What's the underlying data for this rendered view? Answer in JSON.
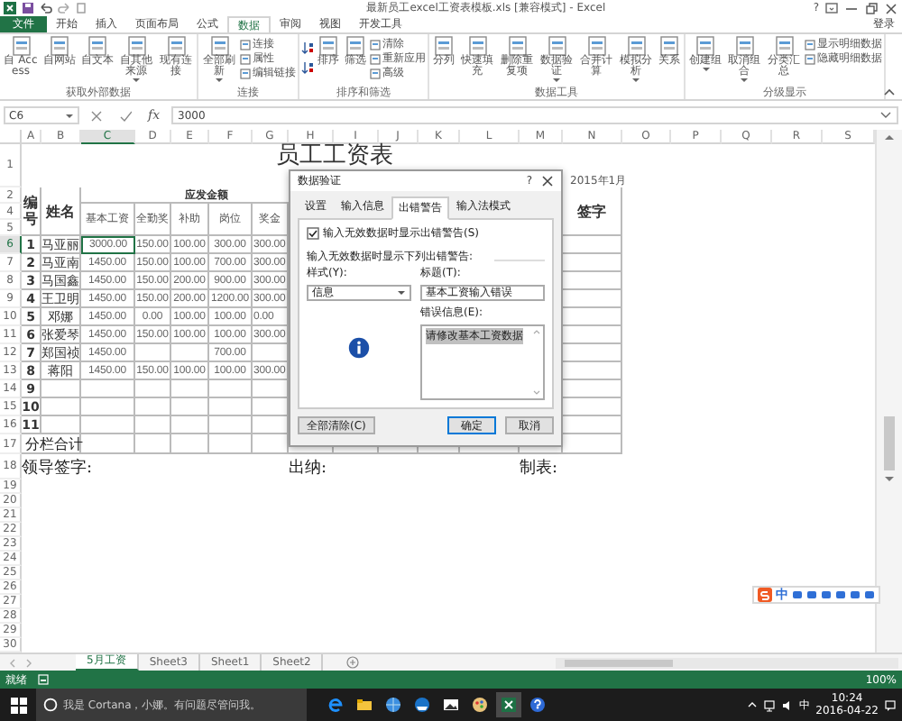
{
  "window": {
    "title": "最新员工excel工资表模板.xls  [兼容模式] - Excel",
    "help": "?"
  },
  "ribbon_tabs": [
    {
      "label": "文件",
      "kind": "file",
      "selected": false
    },
    {
      "label": "开始",
      "kind": "tab",
      "selected": false
    },
    {
      "label": "插入",
      "kind": "tab",
      "selected": false
    },
    {
      "label": "页面布局",
      "kind": "tab",
      "selected": false
    },
    {
      "label": "公式",
      "kind": "tab",
      "selected": false
    },
    {
      "label": "数据",
      "kind": "tab",
      "selected": true
    },
    {
      "label": "审阅",
      "kind": "tab",
      "selected": false
    },
    {
      "label": "视图",
      "kind": "tab",
      "selected": false
    },
    {
      "label": "开发工具",
      "kind": "tab",
      "selected": false
    }
  ],
  "sign_in": "登录",
  "ribbon_groups": [
    {
      "title": "获取外部数据",
      "items": [
        {
          "kind": "large",
          "label": "自 Access",
          "dropdown": false
        },
        {
          "kind": "large",
          "label": "自网站",
          "dropdown": false
        },
        {
          "kind": "large",
          "label": "自文本",
          "dropdown": false
        },
        {
          "kind": "large",
          "label": "自其他来源",
          "dropdown": true
        },
        {
          "kind": "large",
          "label": "现有连接",
          "dropdown": false
        }
      ]
    },
    {
      "title": "连接",
      "items": [
        {
          "kind": "large",
          "label": "全部刷新",
          "dropdown": true
        },
        {
          "kind": "small",
          "label": "连接",
          "dropdown": false
        },
        {
          "kind": "small",
          "label": "属性",
          "dropdown": false
        },
        {
          "kind": "small",
          "label": "编辑链接",
          "dropdown": false
        }
      ]
    },
    {
      "title": "排序和筛选",
      "items": [
        {
          "kind": "sort"
        },
        {
          "kind": "sort"
        },
        {
          "kind": "large",
          "label": "排序",
          "dropdown": false
        },
        {
          "kind": "large",
          "label": "筛选",
          "dropdown": false
        },
        {
          "kind": "small",
          "label": "清除",
          "dropdown": false
        },
        {
          "kind": "small",
          "label": "重新应用",
          "dropdown": false
        },
        {
          "kind": "small",
          "label": "高级",
          "dropdown": false
        }
      ]
    },
    {
      "title": "数据工具",
      "items": [
        {
          "kind": "large",
          "label": "分列",
          "dropdown": false
        },
        {
          "kind": "large",
          "label": "快速填充",
          "dropdown": false
        },
        {
          "kind": "large",
          "label": "删除重复项",
          "dropdown": false
        },
        {
          "kind": "large",
          "label": "数据验证",
          "dropdown": true
        },
        {
          "kind": "large",
          "label": "合并计算",
          "dropdown": false
        },
        {
          "kind": "large",
          "label": "模拟分析",
          "dropdown": true
        },
        {
          "kind": "large",
          "label": "关系",
          "dropdown": false
        }
      ]
    },
    {
      "title": "分级显示",
      "items": [
        {
          "kind": "large",
          "label": "创建组",
          "dropdown": true
        },
        {
          "kind": "large",
          "label": "取消组合",
          "dropdown": true
        },
        {
          "kind": "large",
          "label": "分类汇总",
          "dropdown": false
        },
        {
          "kind": "small",
          "label": "显示明细数据",
          "dropdown": false
        },
        {
          "kind": "small",
          "label": "隐藏明细数据",
          "dropdown": false
        }
      ]
    }
  ],
  "formula_bar": {
    "name_box": "C6",
    "function_label": "fx",
    "value": "3000"
  },
  "sheet": {
    "columns": [
      {
        "label": "A",
        "selected": false
      },
      {
        "label": "B",
        "selected": false
      },
      {
        "label": "C",
        "selected": true
      },
      {
        "label": "D",
        "selected": false
      },
      {
        "label": "E",
        "selected": false
      },
      {
        "label": "F",
        "selected": false
      },
      {
        "label": "G",
        "selected": false
      },
      {
        "label": "H",
        "selected": false
      },
      {
        "label": "I",
        "selected": false
      },
      {
        "label": "J",
        "selected": false
      },
      {
        "label": "K",
        "selected": false
      },
      {
        "label": "L",
        "selected": false
      },
      {
        "label": "M",
        "selected": false
      },
      {
        "label": "N",
        "selected": false
      },
      {
        "label": "O",
        "selected": false
      },
      {
        "label": "P",
        "selected": false
      },
      {
        "label": "Q",
        "selected": false
      },
      {
        "label": "R",
        "selected": false
      },
      {
        "label": "S",
        "selected": false
      }
    ],
    "row_numbers": [
      {
        "label": "1",
        "selected": false
      },
      {
        "label": "2",
        "selected": false
      },
      {
        "label": "4",
        "selected": false
      },
      {
        "label": "5",
        "selected": false
      },
      {
        "label": "6",
        "selected": true
      },
      {
        "label": "7",
        "selected": false
      },
      {
        "label": "8",
        "selected": false
      },
      {
        "label": "9",
        "selected": false
      },
      {
        "label": "10",
        "selected": false
      },
      {
        "label": "11",
        "selected": false
      },
      {
        "label": "12",
        "selected": false
      },
      {
        "label": "13",
        "selected": false
      },
      {
        "label": "14",
        "selected": false
      },
      {
        "label": "15",
        "selected": false
      },
      {
        "label": "16",
        "selected": false
      },
      {
        "label": "17",
        "selected": false
      },
      {
        "label": "18",
        "selected": false
      },
      {
        "label": "19",
        "selected": false
      },
      {
        "label": "20",
        "selected": false
      },
      {
        "label": "21",
        "selected": false
      },
      {
        "label": "22",
        "selected": false
      },
      {
        "label": "23",
        "selected": false
      },
      {
        "label": "24",
        "selected": false
      },
      {
        "label": "25",
        "selected": false
      },
      {
        "label": "26",
        "selected": false
      },
      {
        "label": "27",
        "selected": false
      },
      {
        "label": "28",
        "selected": false
      },
      {
        "label": "29",
        "selected": false
      },
      {
        "label": "30",
        "selected": false
      }
    ],
    "title": "员工工资表",
    "period": "2015年1月",
    "headers": {
      "number": "编号",
      "name": "姓名",
      "group": "应发金额",
      "columns": [
        "基本工资",
        "全勤奖",
        "补助",
        "岗位",
        "奖金"
      ],
      "signature": "签字"
    },
    "rows": [
      {
        "number": "1",
        "name": "马亚丽",
        "base_pay": "3000.00",
        "attendance_bonus": "150.00",
        "allowance": "100.00",
        "post_pay": "300.00",
        "bonus": "300.00",
        "selected": true
      },
      {
        "number": "2",
        "name": "马亚南",
        "base_pay": "1450.00",
        "attendance_bonus": "150.00",
        "allowance": "100.00",
        "post_pay": "700.00",
        "bonus": "300.00",
        "selected": false
      },
      {
        "number": "3",
        "name": "马国鑫",
        "base_pay": "1450.00",
        "attendance_bonus": "150.00",
        "allowance": "200.00",
        "post_pay": "900.00",
        "bonus": "300.00",
        "selected": false
      },
      {
        "number": "4",
        "name": "王卫明",
        "base_pay": "1450.00",
        "attendance_bonus": "150.00",
        "allowance": "200.00",
        "post_pay": "1200.00",
        "bonus": "300.00",
        "selected": false
      },
      {
        "number": "5",
        "name": "邓娜",
        "base_pay": "1450.00",
        "attendance_bonus": "0.00",
        "allowance": "100.00",
        "post_pay": "100.00",
        "bonus": "0.00",
        "selected": false
      },
      {
        "number": "6",
        "name": "张爱琴",
        "base_pay": "1450.00",
        "attendance_bonus": "150.00",
        "allowance": "100.00",
        "post_pay": "100.00",
        "bonus": "300.00",
        "selected": false
      },
      {
        "number": "7",
        "name": "郑国祯",
        "base_pay": "1450.00",
        "post_pay": "700.00",
        "selected": false
      },
      {
        "number": "8",
        "name": "蒋阳",
        "base_pay": "1450.00",
        "attendance_bonus": "150.00",
        "allowance": "100.00",
        "post_pay": "100.00",
        "bonus": "300.00",
        "selected": false
      },
      {
        "number": "9",
        "selected": false
      },
      {
        "number": "10",
        "selected": false
      },
      {
        "number": "11",
        "selected": false
      }
    ],
    "subtotal_label": "分栏合计",
    "signatures": [
      "领导签字:",
      "出纳:",
      "制表:"
    ]
  },
  "dialog": {
    "title": "数据验证",
    "help": "?",
    "tabs": [
      {
        "label": "设置",
        "selected": false
      },
      {
        "label": "输入信息",
        "selected": false
      },
      {
        "label": "出错警告",
        "selected": true
      },
      {
        "label": "输入法模式",
        "selected": false
      }
    ],
    "show_alert": {
      "label": "输入无效数据时显示出错警告(S)",
      "checked": true
    },
    "section_label": "输入无效数据时显示下列出错警告:",
    "style": {
      "label": "样式(Y):",
      "value": "信息"
    },
    "alert_title": {
      "label": "标题(T):",
      "value": "基本工资输入错误"
    },
    "error_message": {
      "label": "错误信息(E):",
      "value": "请修改基本工资数据",
      "highlighted": true
    },
    "buttons": [
      {
        "label": "全部清除(C)",
        "kind": "normal"
      },
      {
        "label": "确定",
        "kind": "default"
      },
      {
        "label": "取消",
        "kind": "normal"
      }
    ]
  },
  "sheet_tabs": [
    {
      "label": "5月工资",
      "selected": true
    },
    {
      "label": "Sheet3",
      "selected": false
    },
    {
      "label": "Sheet1",
      "selected": false
    },
    {
      "label": "Sheet2",
      "selected": false
    }
  ],
  "status_bar": {
    "text": "就绪",
    "zoom": "100%"
  },
  "ime_toolbar": {
    "mode": "中"
  },
  "taskbar": {
    "search_placeholder": "我是 Cortana，小娜。有问题尽管问我。",
    "apps": [
      {
        "active": false
      },
      {
        "active": false
      },
      {
        "active": false
      },
      {
        "active": false
      },
      {
        "active": false
      },
      {
        "active": false
      },
      {
        "active": true
      },
      {
        "active": false
      }
    ],
    "ime": "中",
    "time": "10:24",
    "date": "2016-04-22"
  }
}
